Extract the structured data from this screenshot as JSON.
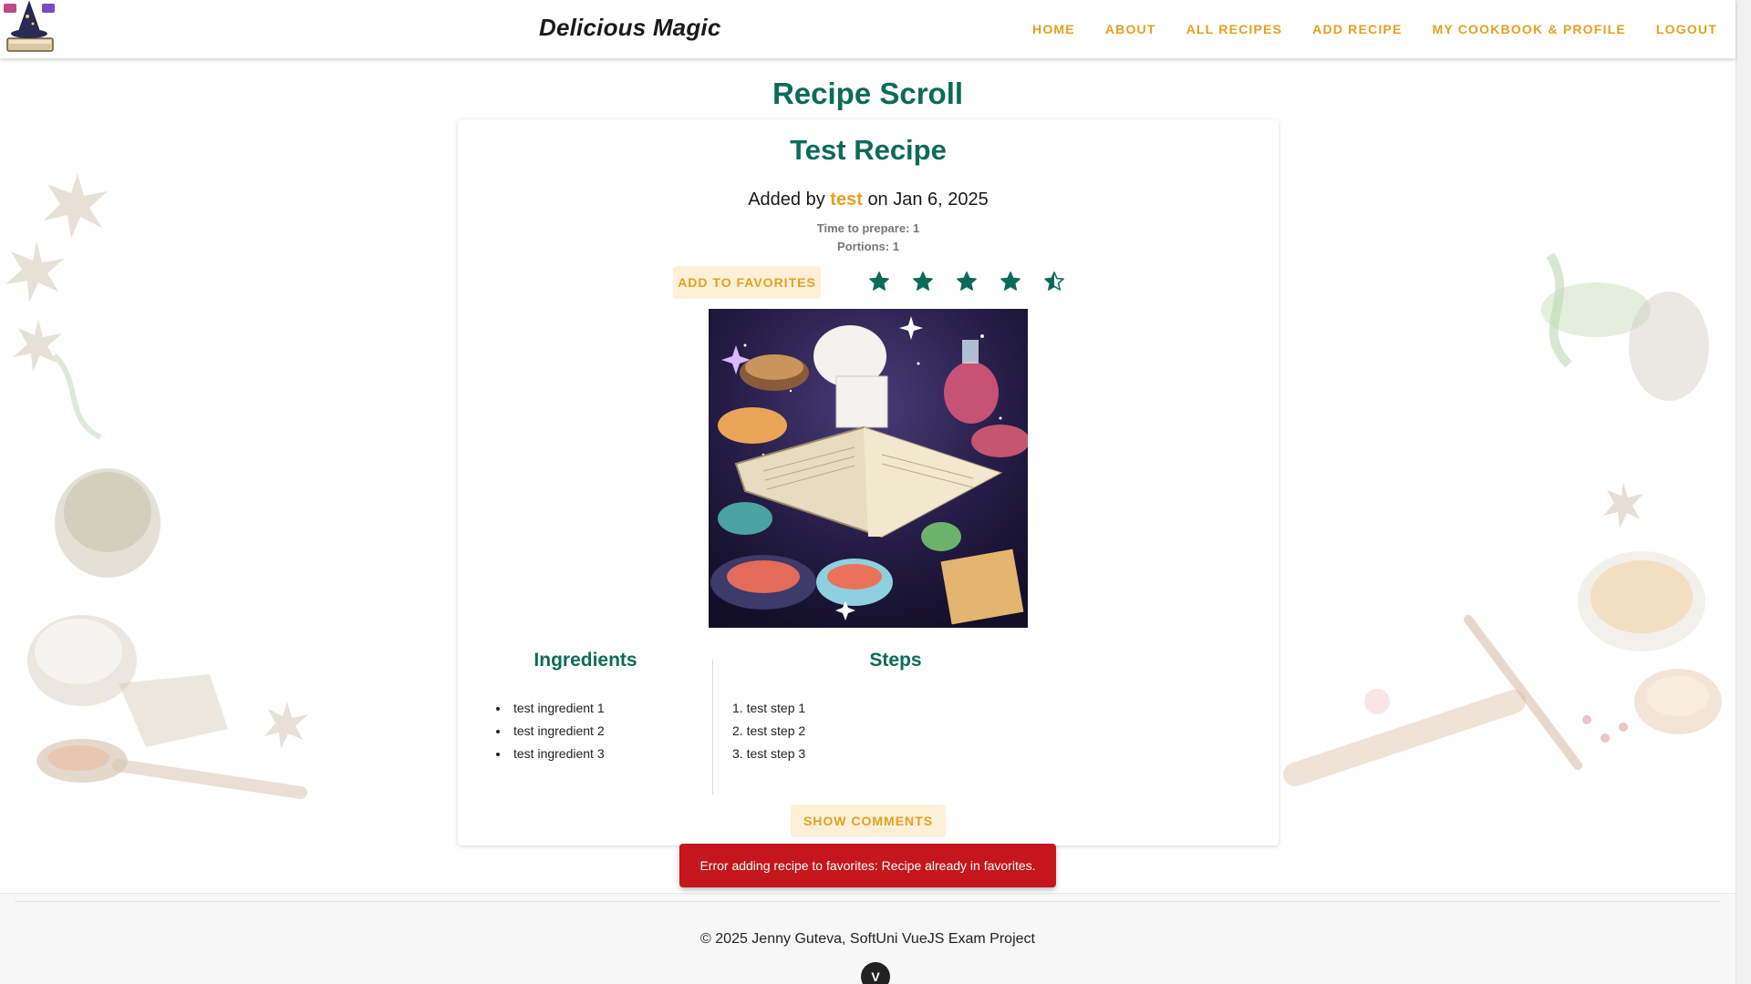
{
  "header": {
    "brand": "Delicious Magic",
    "nav": [
      {
        "label": "HOME"
      },
      {
        "label": "ABOUT"
      },
      {
        "label": "ALL RECIPES"
      },
      {
        "label": "ADD RECIPE"
      },
      {
        "label": "MY COOKBOOK & PROFILE"
      },
      {
        "label": "LOGOUT"
      }
    ]
  },
  "page": {
    "title": "Recipe Scroll"
  },
  "recipe": {
    "name": "Test Recipe",
    "added_prefix": "Added by",
    "author": "test",
    "added_on": "on Jan 6, 2025",
    "time": "Time to prepare: 1",
    "portions": "Portions: 1",
    "favorites_button": "ADD TO FAVORITES",
    "rating": 4.5,
    "rating_max": 5,
    "ingredients_title": "Ingredients",
    "steps_title": "Steps",
    "ingredients": [
      "test ingredient 1",
      "test ingredient 2",
      "test ingredient 3"
    ],
    "steps": [
      "1. test step 1",
      "2. test step 2",
      "3. test step 3"
    ],
    "comments_button": "SHOW COMMENTS"
  },
  "toast": {
    "message": "Error adding recipe to favorites: Recipe already in favorites."
  },
  "footer": {
    "text": "© 2025 Jenny Guteva, SoftUni VueJS Exam Project"
  },
  "colors": {
    "accent": "#e5a01f",
    "primary": "#0c6b58",
    "error": "#c4161c"
  },
  "icons": {
    "logo": "wizard-hat-book-logo",
    "star": "star-icon",
    "vue": "vue-badge-icon"
  }
}
